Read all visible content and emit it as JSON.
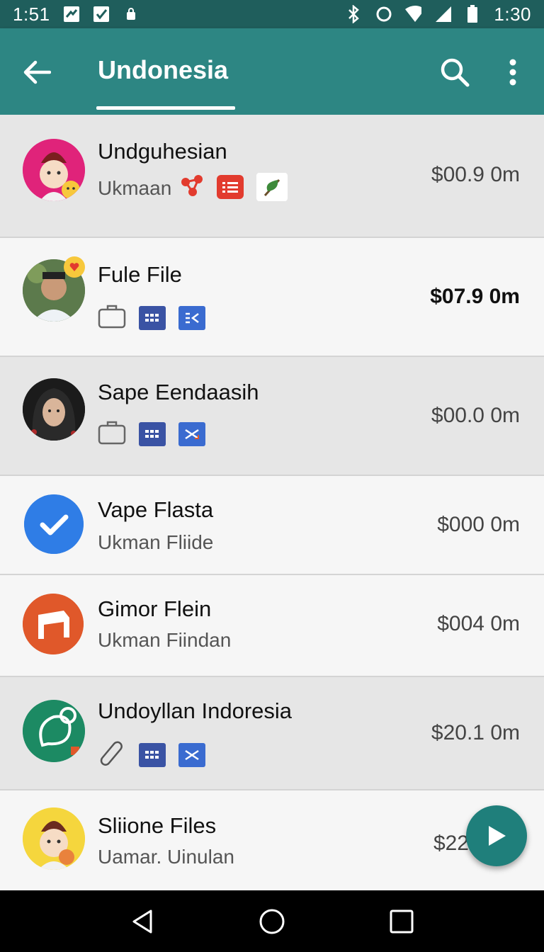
{
  "status_bar": {
    "time_left": "1:51",
    "time_right": "1:30"
  },
  "app_bar": {
    "title": "Undonesia"
  },
  "rows": [
    {
      "title": "Undguhesian",
      "subtitle": "Ukmaan",
      "price": "$00.9 0m"
    },
    {
      "title": "Fule File",
      "price": "$07.9 0m"
    },
    {
      "title": "Sape Eendaasih",
      "price": "$00.0 0m"
    },
    {
      "title": "Vape Flasta",
      "subtitle": "Ukman Fliide",
      "price": "$000 0m"
    },
    {
      "title": "Gimor Flein",
      "subtitle": "Ukman Fiindan",
      "price": "$004 0m"
    },
    {
      "title": "Undoyllan Indoresia",
      "price": "$20.1 0m"
    },
    {
      "title": "Sliione Files",
      "subtitle": "Uamar. Uinulan",
      "price": "$22"
    }
  ],
  "colors": {
    "status_bar": "#1f5e5c",
    "app_bar": "#2d8683",
    "fab": "#1f7f7b",
    "check_blue": "#2f7de6",
    "accent_orange": "#e0582a",
    "green_avatar": "#1c8a63"
  },
  "icons": [
    "back-arrow-icon",
    "search-icon",
    "more-vert-icon",
    "bluetooth-icon",
    "wifi-icon",
    "battery-icon",
    "briefcase-icon",
    "grid-icon",
    "checkmark-icon",
    "play-icon",
    "nav-back-icon",
    "nav-home-icon",
    "nav-recents-icon"
  ]
}
